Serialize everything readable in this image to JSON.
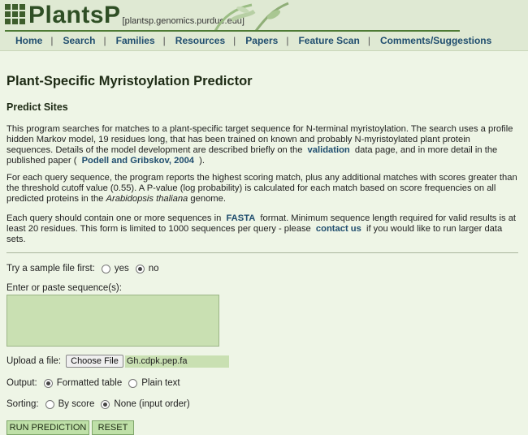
{
  "header": {
    "logo_text": "PlantsP",
    "logo_sub": "[plantsp.genomics.purdue.edu]",
    "nav": [
      "Home",
      "Search",
      "Families",
      "Resources",
      "Papers",
      "Feature Scan",
      "Comments/Suggestions"
    ]
  },
  "page": {
    "title": "Plant-Specific Myristoylation Predictor",
    "subtitle": "Predict Sites",
    "p1_a": "This program searches for matches to a plant-specific target sequence for N-terminal myristoylation. The search uses a profile hidden Markov model, 19 residues long, that has been trained on known and probably N-myristoylated plant protein sequences. Details of the model development are described briefly on the",
    "p1_link1": "validation",
    "p1_b": "data page, and in more detail in the published paper (",
    "p1_link2": "Podell and Gribskov, 2004",
    "p1_c": ").",
    "p2_a": "For each query sequence, the program reports the highest scoring match, plus any additional matches with scores greater than the threshold cutoff value (0.55). A P-value (log probability) is calculated for each match based on score frequencies on all predicted proteins in the",
    "p2_em": "Arabidopsis thaliana",
    "p2_b": "genome.",
    "p3_a": "Each query should contain one or more sequences in",
    "p3_link1": "FASTA",
    "p3_b": "format. Minimum sequence length required for valid results is at least 20 residues. This form is limited to 1000 sequences per query - please",
    "p3_link2": "contact us",
    "p3_c": "if you would like to run larger data sets."
  },
  "form": {
    "sample_label": "Try a sample file first:",
    "sample_yes": "yes",
    "sample_no": "no",
    "paste_label": "Enter or paste sequence(s):",
    "upload_label": "Upload a file:",
    "choose_file": "Choose File",
    "file_name": "Gh.cdpk.pep.fa",
    "output_label": "Output:",
    "output_formatted": "Formatted table",
    "output_plain": "Plain text",
    "sorting_label": "Sorting:",
    "sort_score": "By score",
    "sort_none": "None (input order)",
    "run_button": "RUN PREDICTION",
    "reset_button": "RESET"
  }
}
